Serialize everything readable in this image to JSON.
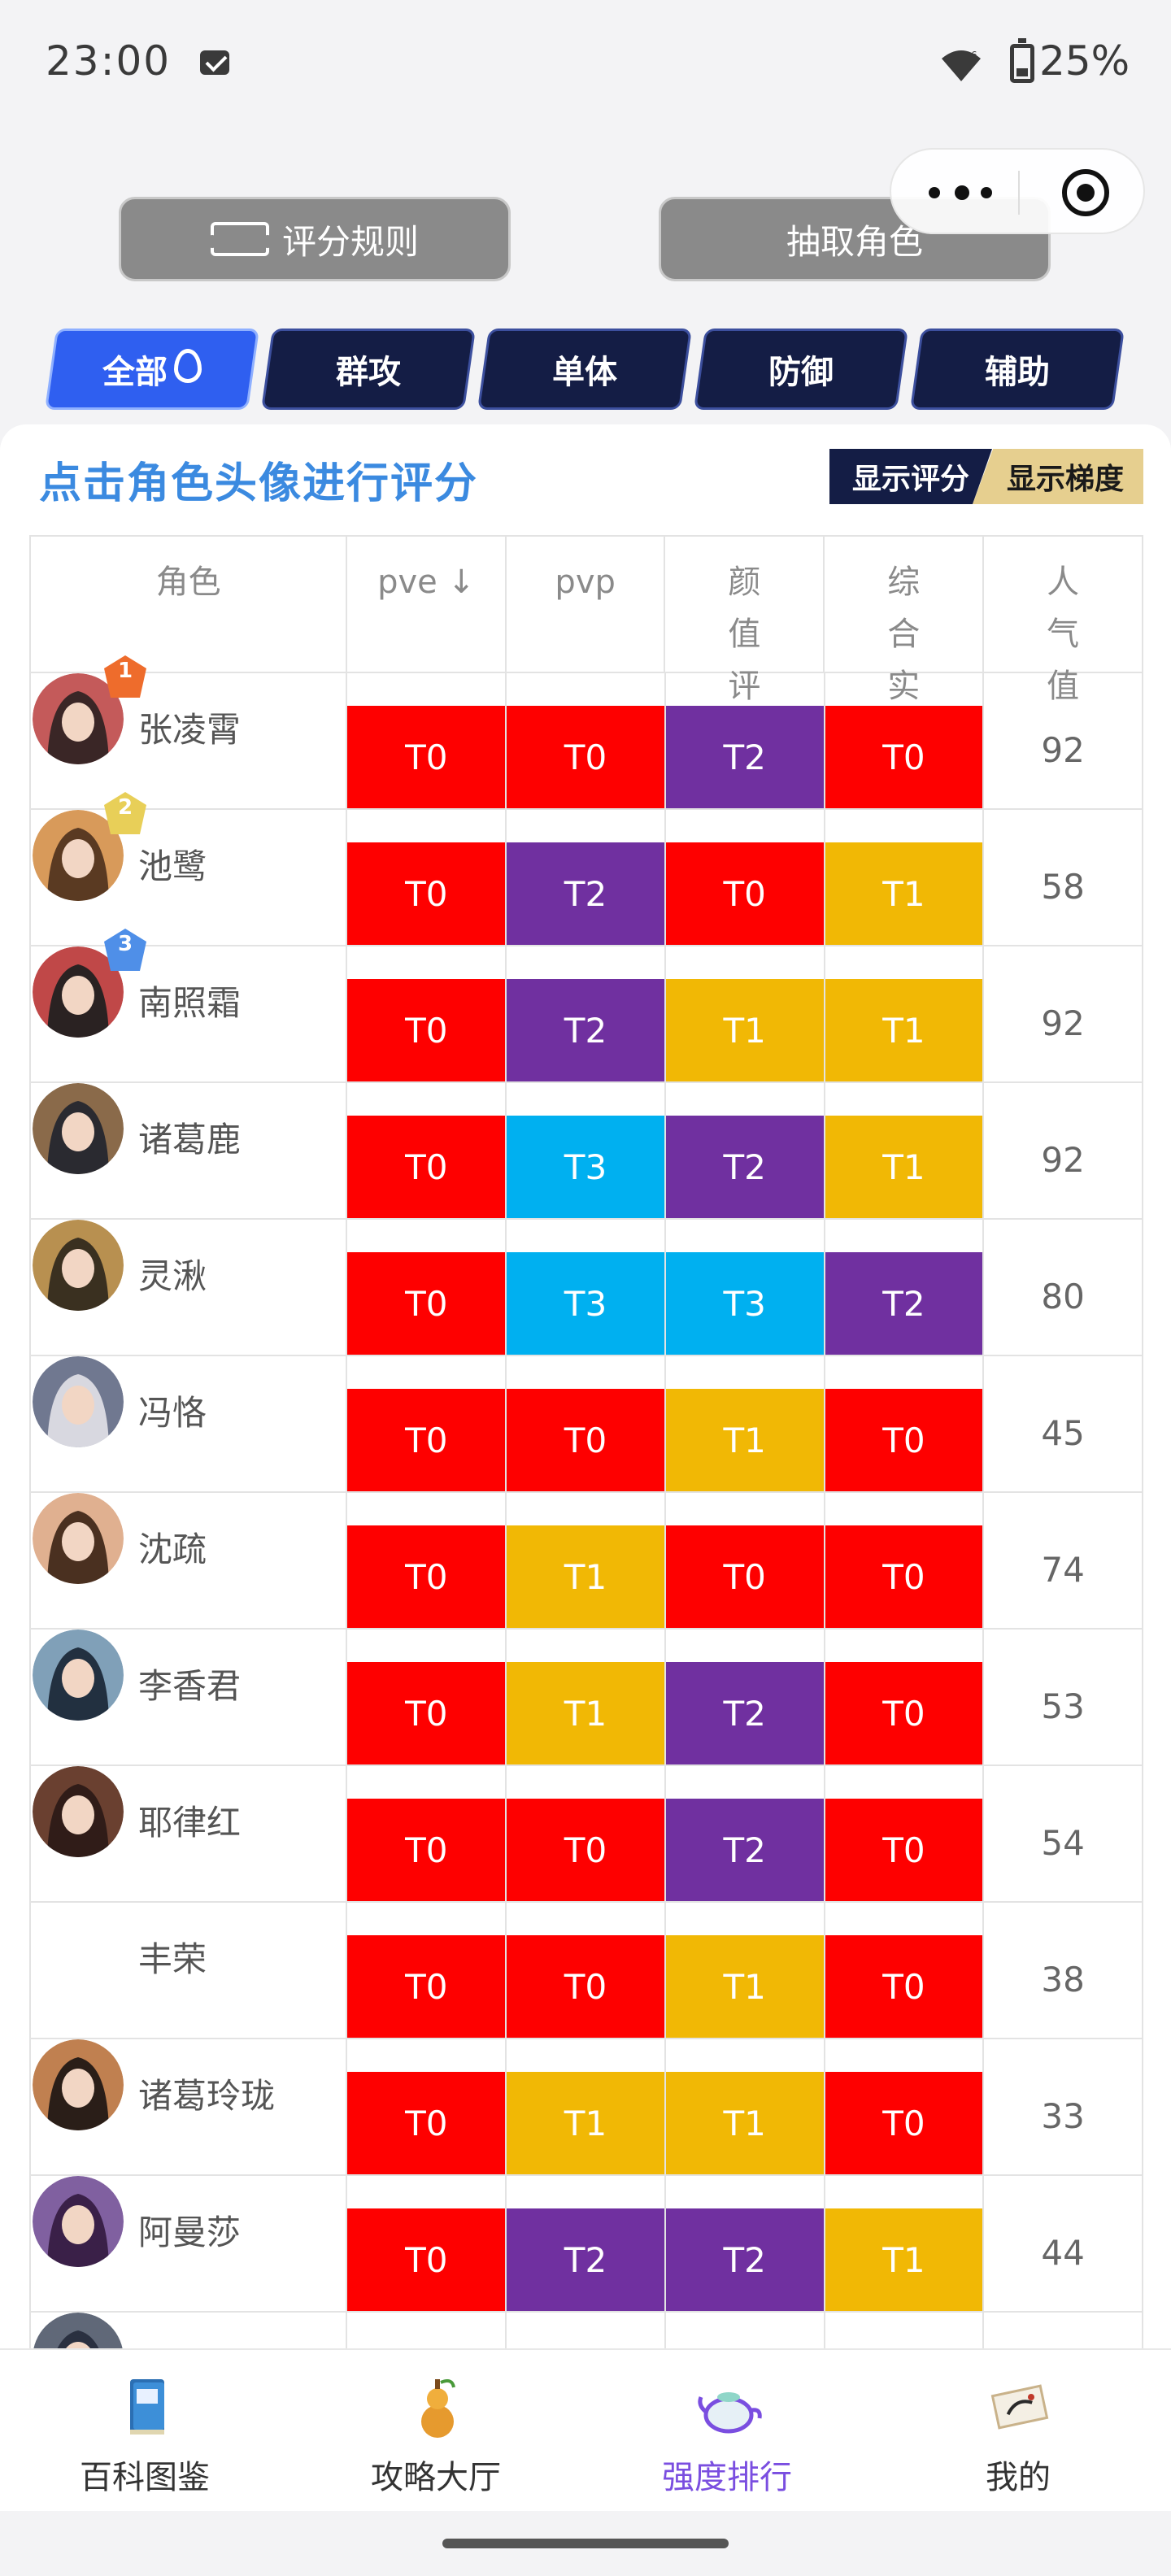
{
  "status_bar": {
    "time": "23:00",
    "battery": "25%"
  },
  "actions": {
    "rules_label": "评分规则",
    "draw_label": "抽取角色"
  },
  "tabs": [
    {
      "label": "全部",
      "active": true
    },
    {
      "label": "群攻",
      "active": false
    },
    {
      "label": "单体",
      "active": false
    },
    {
      "label": "防御",
      "active": false
    },
    {
      "label": "辅助",
      "active": false
    }
  ],
  "card": {
    "title": "点击角色头像进行评分",
    "toggle_score": "显示评分",
    "toggle_tier": "显示梯度"
  },
  "table": {
    "headers": {
      "role": "角色",
      "pve": "pve ↓",
      "pvp": "pvp",
      "looks": "颜值评分",
      "strength": "综合实力",
      "popularity": "人气值"
    },
    "rows": [
      {
        "name": "张凌霄",
        "rank": "1",
        "pve": "T0",
        "pvp": "T0",
        "looks": "T2",
        "strength": "T0",
        "popularity": "92"
      },
      {
        "name": "池鹭",
        "rank": "2",
        "pve": "T0",
        "pvp": "T2",
        "looks": "T0",
        "strength": "T1",
        "popularity": "58"
      },
      {
        "name": "南照霜",
        "rank": "3",
        "pve": "T0",
        "pvp": "T2",
        "looks": "T1",
        "strength": "T1",
        "popularity": "92"
      },
      {
        "name": "诸葛鹿",
        "rank": "",
        "pve": "T0",
        "pvp": "T3",
        "looks": "T2",
        "strength": "T1",
        "popularity": "92"
      },
      {
        "name": "灵湫",
        "rank": "",
        "pve": "T0",
        "pvp": "T3",
        "looks": "T3",
        "strength": "T2",
        "popularity": "80"
      },
      {
        "name": "冯恪",
        "rank": "",
        "pve": "T0",
        "pvp": "T0",
        "looks": "T1",
        "strength": "T0",
        "popularity": "45"
      },
      {
        "name": "沈疏",
        "rank": "",
        "pve": "T0",
        "pvp": "T1",
        "looks": "T0",
        "strength": "T0",
        "popularity": "74"
      },
      {
        "name": "李香君",
        "rank": "",
        "pve": "T0",
        "pvp": "T1",
        "looks": "T2",
        "strength": "T0",
        "popularity": "53"
      },
      {
        "name": "耶律红",
        "rank": "",
        "pve": "T0",
        "pvp": "T0",
        "looks": "T2",
        "strength": "T0",
        "popularity": "54"
      },
      {
        "name": "丰荣",
        "rank": "",
        "pve": "T0",
        "pvp": "T0",
        "looks": "T1",
        "strength": "T0",
        "popularity": "38"
      },
      {
        "name": "诸葛玲珑",
        "rank": "",
        "pve": "T0",
        "pvp": "T1",
        "looks": "T1",
        "strength": "T0",
        "popularity": "33"
      },
      {
        "name": "阿曼莎",
        "rank": "",
        "pve": "T0",
        "pvp": "T2",
        "looks": "T2",
        "strength": "T1",
        "popularity": "44"
      },
      {
        "name": "",
        "rank": "",
        "pve": "",
        "pvp": "",
        "looks": "",
        "strength": "",
        "popularity": ""
      }
    ]
  },
  "tier_colors": {
    "T0": "#fe0000",
    "T1": "#f1b805",
    "T2": "#7030a0",
    "T3": "#00b0f0"
  },
  "rank_badge_colors": {
    "1": "#ee6c2c",
    "2": "#e8cf58",
    "3": "#4f8fe8"
  },
  "bottom_nav": [
    {
      "label": "百科图鉴",
      "icon": "encyclopedia-book-icon",
      "active": false
    },
    {
      "label": "攻略大厅",
      "icon": "gourd-icon",
      "active": false
    },
    {
      "label": "强度排行",
      "icon": "teapot-icon",
      "active": true
    },
    {
      "label": "我的",
      "icon": "scroll-painting-icon",
      "active": false
    }
  ],
  "colors": {
    "accent_blue": "#3b8ae0",
    "tab_navy": "#141d45",
    "tab_active": "#2f5ff0",
    "nav_active": "#7a4ee0"
  }
}
